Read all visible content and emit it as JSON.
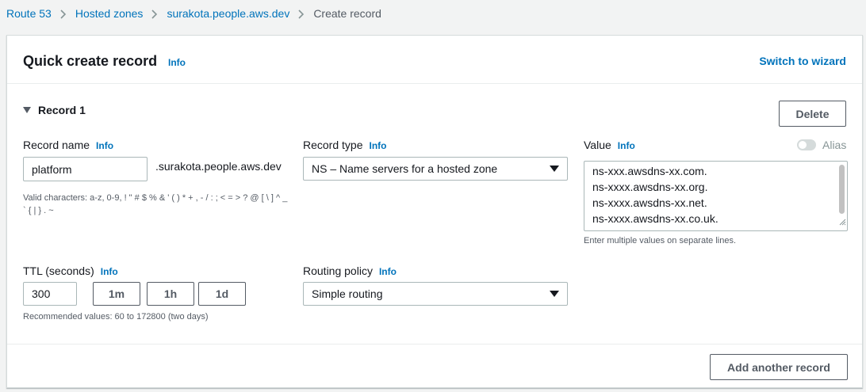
{
  "breadcrumb": {
    "items": [
      "Route 53",
      "Hosted zones",
      "surakota.people.aws.dev"
    ],
    "current": "Create record"
  },
  "panel": {
    "title": "Quick create record",
    "info": "Info",
    "switch_link": "Switch to wizard"
  },
  "record": {
    "section_title": "Record 1",
    "delete_label": "Delete",
    "name": {
      "label": "Record name",
      "info": "Info",
      "value": "platform",
      "suffix": ".surakota.people.aws.dev",
      "hint": "Valid characters: a-z, 0-9, ! \" # $ % & ' ( ) * + , - / : ; < = > ? @ [ \\ ] ^ _ ` { | } . ~"
    },
    "type": {
      "label": "Record type",
      "info": "Info",
      "selected": "NS – Name servers for a hosted zone"
    },
    "value": {
      "label": "Value",
      "info": "Info",
      "lines": [
        "ns-xxx.awsdns-xx.com.",
        "ns-xxxx.awsdns-xx.org.",
        "ns-xxxx.awsdns-xx.net.",
        "ns-xxxx.awsdns-xx.co.uk."
      ],
      "hint": "Enter multiple values on separate lines.",
      "alias_label": "Alias",
      "alias_enabled": false
    },
    "ttl": {
      "label": "TTL (seconds)",
      "info": "Info",
      "value": "300",
      "presets": [
        "1m",
        "1h",
        "1d"
      ],
      "hint": "Recommended values: 60 to 172800 (two days)"
    },
    "routing": {
      "label": "Routing policy",
      "info": "Info",
      "selected": "Simple routing"
    }
  },
  "footer": {
    "add_label": "Add another record"
  },
  "colors": {
    "link": "#0073bb",
    "text": "#16191f",
    "muted": "#545b64",
    "border": "#aab7b8",
    "background": "#f2f3f3"
  }
}
